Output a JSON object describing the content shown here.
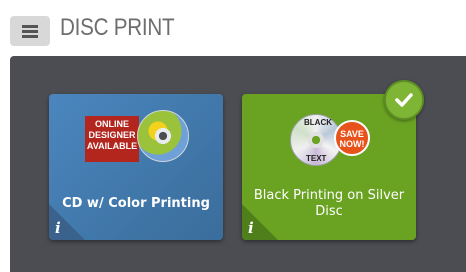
{
  "header": {
    "menu_icon": "hamburger-menu-icon",
    "title": "DISC PRINT"
  },
  "products": [
    {
      "label": "CD w/ Color Printing",
      "badge_lines": [
        "ONLINE",
        "DESIGNER",
        "AVAILABLE"
      ],
      "selected": false,
      "color": "#4a86be"
    },
    {
      "label": "Black Printing on Silver Disc",
      "disc_text_top": "BLACK",
      "disc_text_bottom": "TEXT",
      "badge_lines": [
        "SAVE",
        "NOW!"
      ],
      "selected": true,
      "color": "#6aa222"
    }
  ],
  "icons": {
    "info": "i",
    "selected": "checkmark-icon"
  },
  "colors": {
    "panel": "#4b4d52",
    "save_badge": "#e8531b",
    "online_badge": "#b3261e",
    "check": "#7fb535"
  }
}
